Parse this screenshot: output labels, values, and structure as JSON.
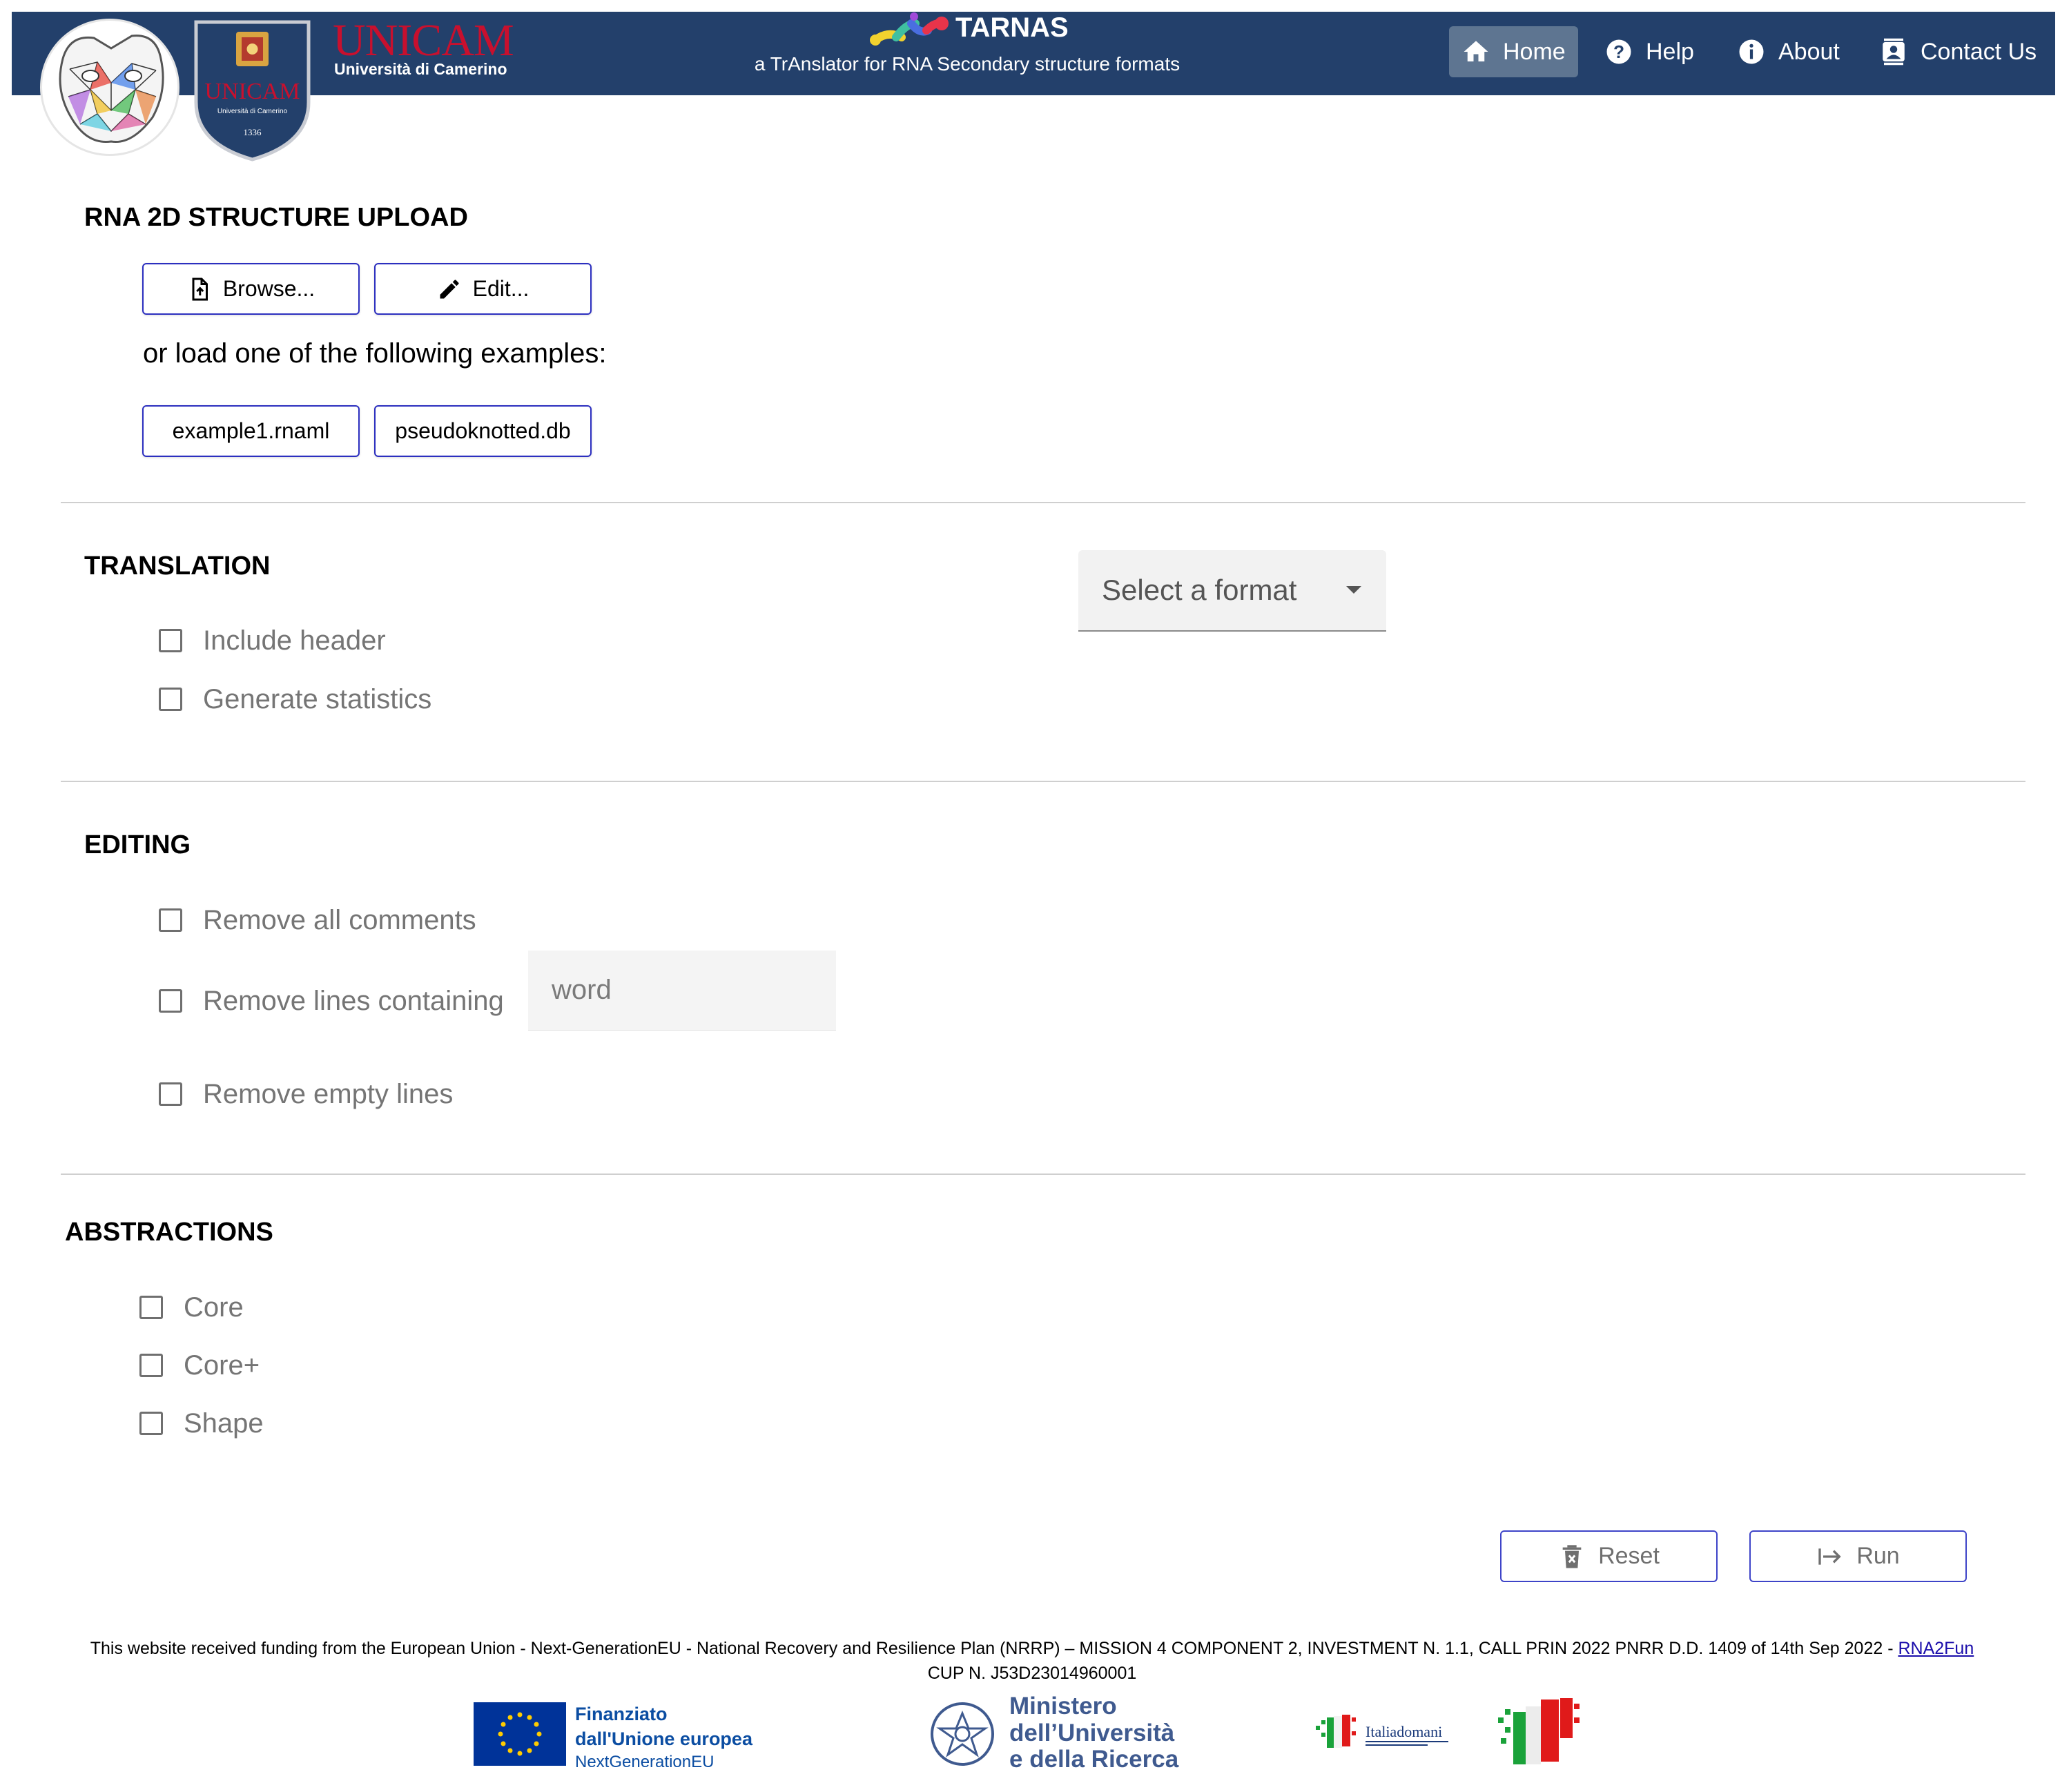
{
  "header": {
    "university_name": "UNICAM",
    "university_subtitle": "Università di Camerino",
    "shield_text": "UNICAM",
    "shield_subtext": "Università di Camerino",
    "shield_year": "1336",
    "app_title": "TARNAS",
    "app_subtitle": "a TrAnslator for RNA Secondary structure formats",
    "nav": [
      {
        "label": "Home",
        "icon": "home-icon",
        "active": true
      },
      {
        "label": "Help",
        "icon": "help-icon",
        "active": false
      },
      {
        "label": "About",
        "icon": "info-icon",
        "active": false
      },
      {
        "label": "Contact Us",
        "icon": "contact-icon",
        "active": false
      }
    ]
  },
  "upload": {
    "title": "RNA 2D STRUCTURE UPLOAD",
    "browse_label": "Browse...",
    "edit_label": "Edit...",
    "examples_label": "or load one of the following examples:",
    "examples": [
      "example1.rnaml",
      "pseudoknotted.db"
    ]
  },
  "translation": {
    "title": "TRANSLATION",
    "options": [
      "Include header",
      "Generate statistics"
    ],
    "format_select": "Select a format"
  },
  "editing": {
    "title": "EDITING",
    "options": [
      "Remove all comments",
      "Remove lines containing",
      "Remove empty lines"
    ],
    "word_placeholder": "word"
  },
  "abstractions": {
    "title": "ABSTRACTIONS",
    "options": [
      "Core",
      "Core+",
      "Shape"
    ]
  },
  "actions": {
    "reset_label": "Reset",
    "run_label": "Run"
  },
  "footer": {
    "funding_text": "This website received funding from the European Union - Next-GenerationEU - National Recovery and Resilience Plan (NRRP) – MISSION 4 COMPONENT 2, INVESTMENT N. 1.1, CALL PRIN 2022 PNRR D.D. 1409 of 14th Sep 2022 - ",
    "funding_link": "RNA2Fun",
    "cup_text": "CUP N. J53D23014960001",
    "eu_line1": "Finanziato",
    "eu_line2": "dall'Unione europea",
    "eu_line3": "NextGenerationEU",
    "mur_line1": "Ministero",
    "mur_line2": "dell’Università",
    "mur_line3": "e della Ricerca",
    "italia_logo_text": "Italiadomani"
  },
  "colors": {
    "header_bg": "#23406b",
    "active_nav_bg": "#5e7591",
    "button_border": "#2c2fbf",
    "unicam_red": "#c8102e",
    "eu_blue": "#0b4da2"
  }
}
